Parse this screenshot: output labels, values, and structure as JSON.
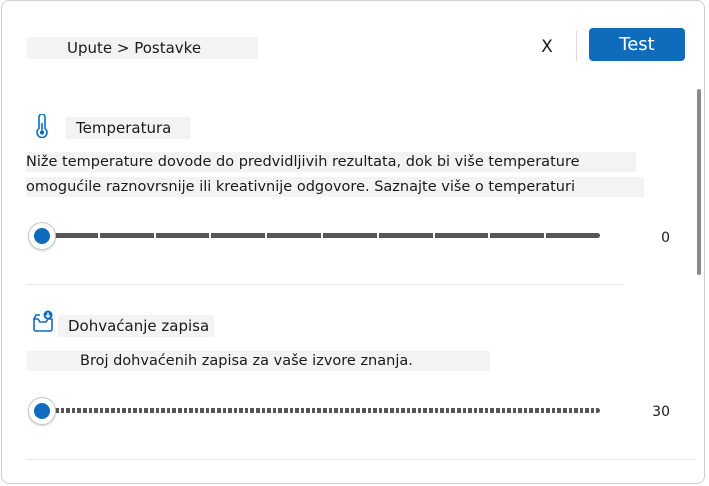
{
  "header": {
    "breadcrumb": "Upute > Postavke",
    "close_label": "X",
    "test_label": "Test"
  },
  "temperature": {
    "icon": "thermometer-icon",
    "title": "Temperatura",
    "desc_line1": "Niže temperature dovode do predvidljivih rezultata, dok bi više temperature",
    "desc_line2": "omogućile raznovrsnije ili kreativnije odgovore. Saznajte više o temperaturi",
    "value": "0",
    "slider_fraction": 0
  },
  "retrieval": {
    "icon": "document-download-icon",
    "title": "Dohvaćanje zapisa",
    "desc": "Broj dohvaćenih zapisa za vaše izvore znanja.",
    "value": "30",
    "slider_fraction": 0
  },
  "colors": {
    "accent": "#0f6cbd",
    "track": "#555555",
    "label_bg": "#f3f3f3"
  }
}
